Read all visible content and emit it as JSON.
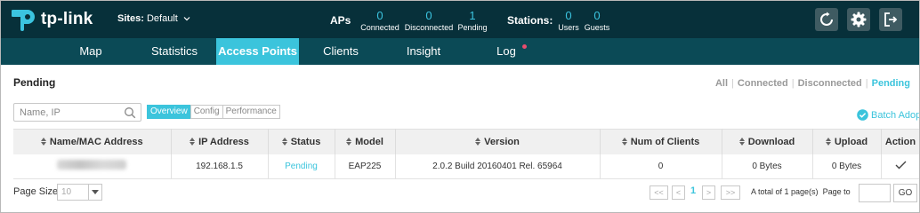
{
  "brand": {
    "name": "tp-link"
  },
  "header": {
    "sites_label": "Sites:",
    "sites_value": "Default",
    "aps_label": "APs",
    "aps": [
      {
        "value": "0",
        "label": "Connected"
      },
      {
        "value": "0",
        "label": "Disconnected"
      },
      {
        "value": "1",
        "label": "Pending"
      }
    ],
    "stations_label": "Stations:",
    "stations": [
      {
        "value": "0",
        "label": "Users"
      },
      {
        "value": "0",
        "label": "Guests"
      }
    ],
    "icons": [
      "refresh-icon",
      "gear-icon",
      "logout-icon"
    ]
  },
  "nav": {
    "items": [
      {
        "label": "Map"
      },
      {
        "label": "Statistics"
      },
      {
        "label": "Access Points"
      },
      {
        "label": "Clients"
      },
      {
        "label": "Insight"
      },
      {
        "label": "Log"
      }
    ],
    "active": "Access Points"
  },
  "section": {
    "title": "Pending",
    "filters": [
      {
        "label": "All"
      },
      {
        "label": "Connected"
      },
      {
        "label": "Disconnected"
      },
      {
        "label": "Pending"
      }
    ],
    "active_filter": "Pending"
  },
  "toolbar": {
    "search_placeholder": "Name, IP",
    "views": [
      {
        "label": "Overview"
      },
      {
        "label": "Config"
      },
      {
        "label": "Performance"
      }
    ],
    "active_view": "Overview",
    "batch_label": "Batch Adopt"
  },
  "table": {
    "columns": [
      {
        "label": "Name/MAC Address"
      },
      {
        "label": "IP Address"
      },
      {
        "label": "Status"
      },
      {
        "label": "Model"
      },
      {
        "label": "Version"
      },
      {
        "label": "Num of Clients"
      },
      {
        "label": "Download"
      },
      {
        "label": "Upload"
      },
      {
        "label": "Action"
      }
    ],
    "rows": [
      {
        "ip": "192.168.1.5",
        "status": "Pending",
        "model": "EAP225",
        "version": "2.0.2 Build 20160401 Rel. 65964",
        "clients": "0",
        "download": "0 Bytes",
        "upload": "0 Bytes"
      }
    ]
  },
  "pager": {
    "page_size_label": "Page Size",
    "page_size": "10",
    "first": "<<",
    "prev": "<",
    "current": "1",
    "next": ">",
    "last": ">>",
    "total": "A total of 1 page(s)",
    "goto_label": "Page to",
    "go_label": "GO"
  },
  "colors": {
    "header": "#07303a",
    "nav": "#0b4a56",
    "accent": "#3bc4dc"
  }
}
